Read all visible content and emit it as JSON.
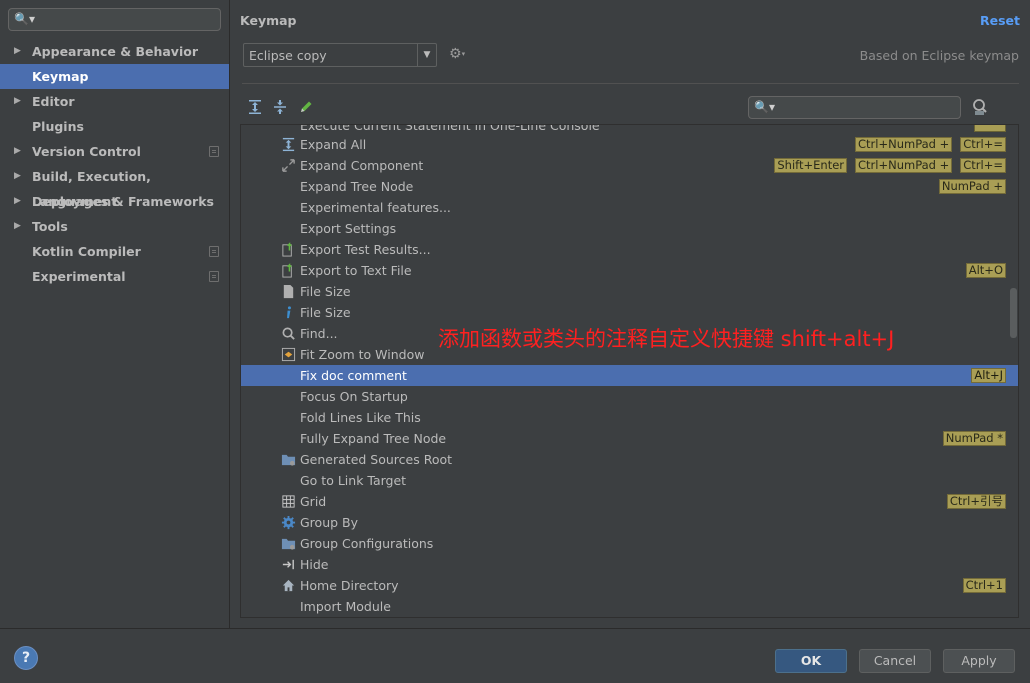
{
  "sidebar": {
    "items": [
      {
        "label": "Appearance & Behavior"
      },
      {
        "label": "Keymap"
      },
      {
        "label": "Editor"
      },
      {
        "label": "Plugins"
      },
      {
        "label": "Version Control"
      },
      {
        "label": "Build, Execution, Deployment"
      },
      {
        "label": "Languages & Frameworks"
      },
      {
        "label": "Tools"
      },
      {
        "label": "Kotlin Compiler"
      },
      {
        "label": "Experimental"
      }
    ]
  },
  "header": {
    "title": "Keymap",
    "reset_label": "Reset",
    "keymap_selected": "Eclipse copy",
    "based_on": "Based on Eclipse keymap"
  },
  "list": {
    "cut_top_label": "Execute Current Statement in One-Line Console",
    "rows": [
      {
        "icon": "expand-all-icon",
        "name": "Expand All",
        "keys": [
          "Ctrl+NumPad +",
          "Ctrl+="
        ]
      },
      {
        "icon": "expand-component-icon",
        "name": "Expand Component",
        "keys": [
          "Shift+Enter",
          "Ctrl+NumPad +",
          "Ctrl+="
        ]
      },
      {
        "icon": "",
        "name": "Expand Tree Node",
        "keys": [
          "NumPad +"
        ]
      },
      {
        "icon": "",
        "name": "Experimental features...",
        "keys": []
      },
      {
        "icon": "",
        "name": "Export Settings",
        "keys": []
      },
      {
        "icon": "export-icon",
        "name": "Export Test Results...",
        "keys": []
      },
      {
        "icon": "export-icon",
        "name": "Export to Text File",
        "keys": [
          "Alt+O"
        ]
      },
      {
        "icon": "file-icon",
        "name": "File Size",
        "keys": []
      },
      {
        "icon": "info-icon",
        "name": "File Size",
        "keys": []
      },
      {
        "icon": "search-icon",
        "name": "Find...",
        "keys": []
      },
      {
        "icon": "fit-zoom-icon",
        "name": "Fit Zoom to Window",
        "keys": []
      },
      {
        "icon": "",
        "name": "Fix doc comment",
        "keys": [
          "Alt+J"
        ]
      },
      {
        "icon": "",
        "name": "Focus On Startup",
        "keys": []
      },
      {
        "icon": "",
        "name": "Fold Lines Like This",
        "keys": []
      },
      {
        "icon": "",
        "name": "Fully Expand Tree Node",
        "keys": [
          "NumPad *"
        ]
      },
      {
        "icon": "folder-icon",
        "name": "Generated Sources Root",
        "keys": []
      },
      {
        "icon": "",
        "name": "Go to Link Target",
        "keys": []
      },
      {
        "icon": "grid-icon",
        "name": "Grid",
        "keys": [
          "Ctrl+引号"
        ]
      },
      {
        "icon": "gear-icon",
        "name": "Group By",
        "keys": []
      },
      {
        "icon": "folder-icon",
        "name": "Group Configurations",
        "keys": []
      },
      {
        "icon": "hide-icon",
        "name": "Hide",
        "keys": []
      },
      {
        "icon": "home-icon",
        "name": "Home Directory",
        "keys": [
          "Ctrl+1"
        ]
      },
      {
        "icon": "",
        "name": "Import Module",
        "keys": []
      }
    ],
    "selected_index": 11
  },
  "annotation": "添加函数或类头的注释自定义快捷键 shift+alt+J",
  "footer": {
    "help_label": "?",
    "ok_label": "OK",
    "cancel_label": "Cancel",
    "apply_label": "Apply"
  },
  "colors": {
    "selection": "#4b6eaf",
    "link": "#589df6",
    "shortcut_badge": "#a99e55",
    "annotation": "#ff2020"
  }
}
